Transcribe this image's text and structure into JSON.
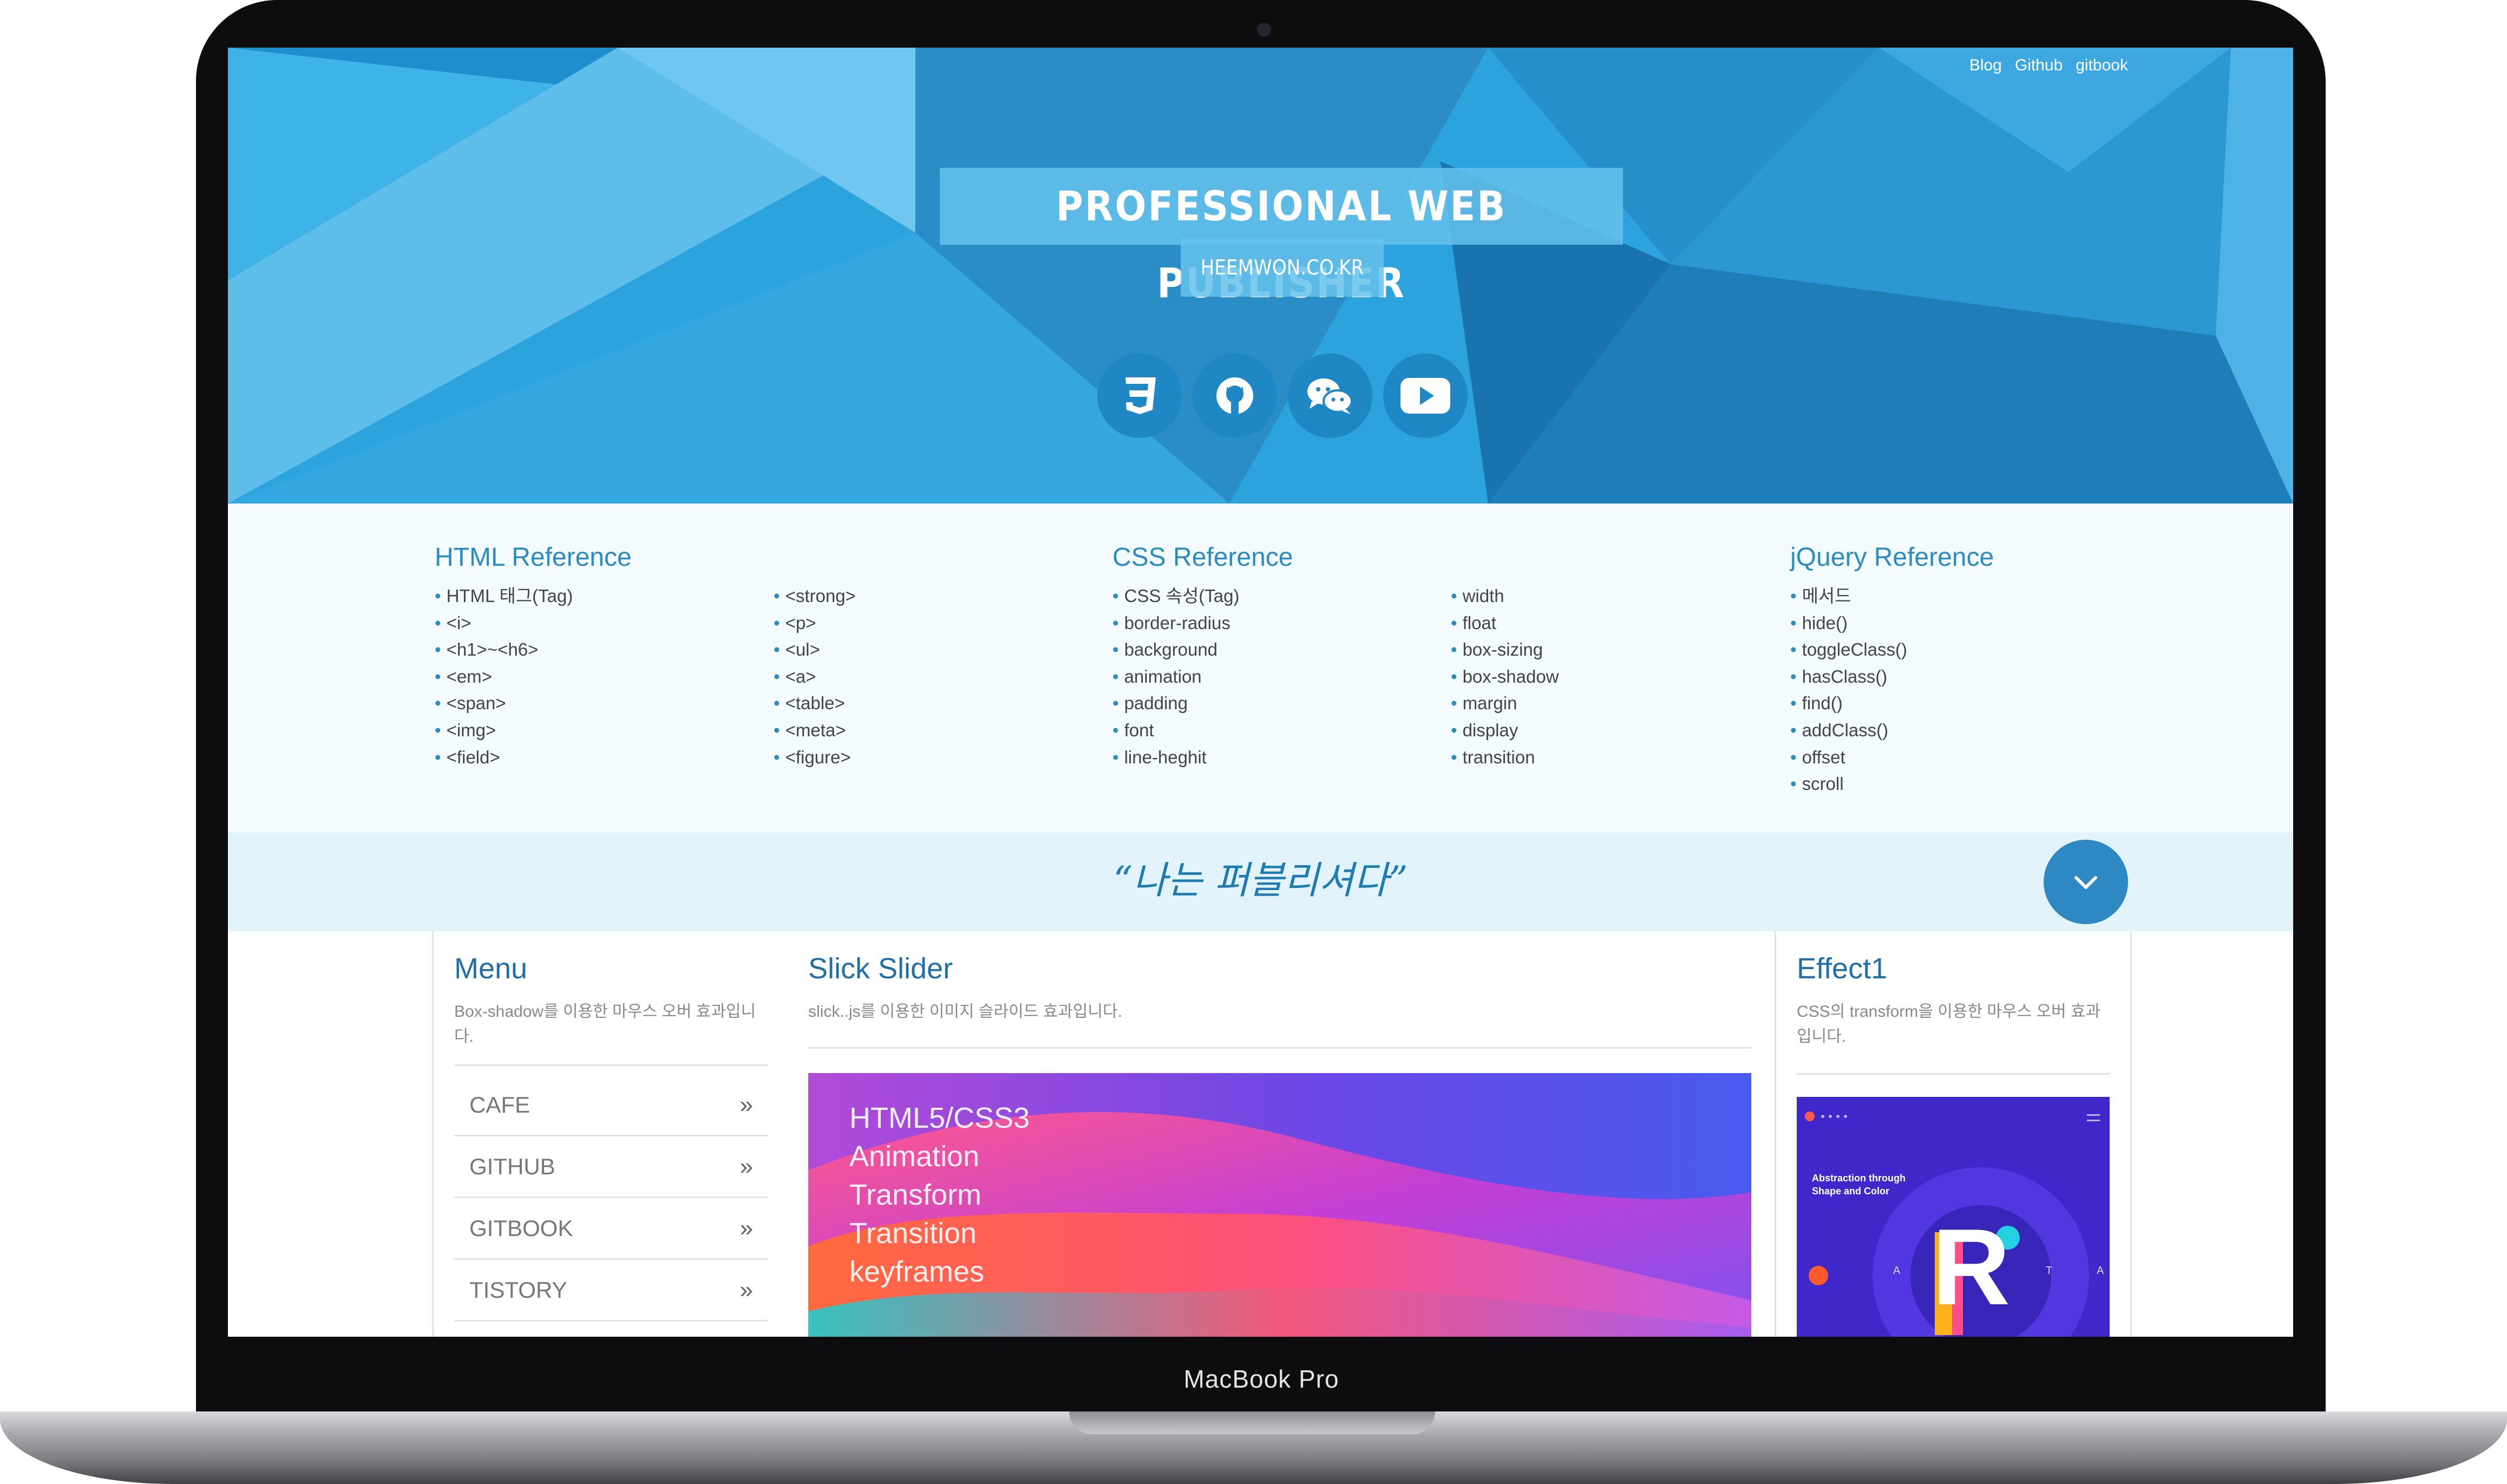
{
  "device": {
    "model_label": "MacBook Pro"
  },
  "top_nav": [
    "Blog",
    "Github",
    "gitbook"
  ],
  "hero": {
    "title": "PROFESSIONAL WEB PUBLISHER",
    "subtitle": "HEEMWON.CO.KR",
    "social_icons": [
      "css3-icon",
      "github-icon",
      "wechat-icon",
      "youtube-icon"
    ]
  },
  "references": {
    "html": {
      "title": "HTML Reference",
      "col1": [
        "HTML 태그(Tag)",
        "<i>",
        "<h1>~<h6>",
        "<em>",
        "<span>",
        "<img>",
        "<field>"
      ],
      "col2": [
        "<strong>",
        "<p>",
        "<ul>",
        "<a>",
        "<table>",
        "<meta>",
        "<figure>"
      ]
    },
    "css": {
      "title": "CSS Reference",
      "col1": [
        "CSS 속성(Tag)",
        "border-radius",
        "background",
        "animation",
        "padding",
        "font",
        "line-heghit"
      ],
      "col2": [
        "width",
        "float",
        "box-sizing",
        "box-shadow",
        "margin",
        "display",
        "transition"
      ]
    },
    "jquery": {
      "title": "jQuery Reference",
      "col1": [
        "메서드",
        "hide()",
        "toggleClass()",
        "hasClass()",
        "find()",
        "addClass()",
        "offset",
        "scroll"
      ]
    }
  },
  "banner": {
    "slogan": "“나는 퍼블리셔다”"
  },
  "menu": {
    "title": "Menu",
    "description": "Box-shadow를 이용한 마우스 오버 효과입니다.",
    "items": [
      {
        "label": "CAFE",
        "arrow": "»"
      },
      {
        "label": "GITHUB",
        "arrow": "»"
      },
      {
        "label": "GITBOOK",
        "arrow": "»"
      },
      {
        "label": "TISTORY",
        "arrow": "»"
      }
    ]
  },
  "slider": {
    "title": "Slick Slider",
    "description": "slick..js를 이용한 이미지 슬라이드 효과입니다.",
    "slide_lines": [
      "HTML5/CSS3",
      "Animation",
      "Transform",
      "Transition",
      "keyframes"
    ]
  },
  "effect": {
    "title": "Effect1",
    "description": "CSS의 transform을 이용한 마우스 오버 효과입니다.",
    "thumb_heading": "Abstraction through Shape and Color",
    "thumb_letter": "R",
    "thumb_side_letters": [
      "A",
      "T",
      "A"
    ]
  },
  "colors": {
    "hero_blue": "#2da3dd",
    "accent_blue": "#2a8cc3",
    "banner_bg": "#e3f3fb",
    "refs_bg": "#f3fbfe"
  }
}
